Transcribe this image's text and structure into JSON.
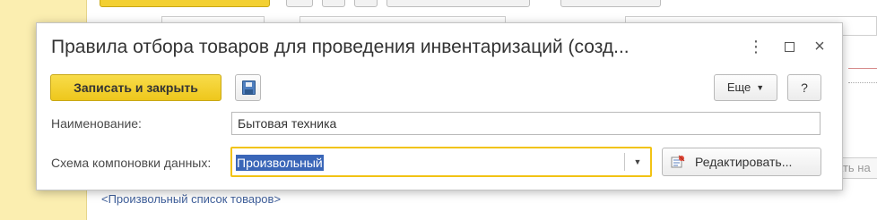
{
  "background": {
    "link_text": "<Произвольный список товаров>",
    "partial_button_text": "ать на"
  },
  "dialog": {
    "title": "Правила отбора товаров для проведения инвентаризаций (созд...",
    "controls": {
      "more_icon": "kebab-vertical-icon",
      "maximize_icon": "maximize-icon",
      "close_icon": "close-icon"
    },
    "toolbar": {
      "save_close_label": "Записать и закрыть",
      "save_icon": "floppy-disk-icon",
      "more_label": "Еще",
      "help_label": "?"
    },
    "fields": {
      "name": {
        "label": "Наименование:",
        "value": "Бытовая техника"
      },
      "schema": {
        "label": "Схема компоновки данных:",
        "value": "Произвольный",
        "edit_button_label": "Редактировать..."
      }
    }
  },
  "colors": {
    "accent_yellow": "#f3d032",
    "left_panel": "#fbeeb0",
    "selection": "#3a66b8",
    "focus_border": "#f2c314",
    "link": "#3f5f9a"
  }
}
